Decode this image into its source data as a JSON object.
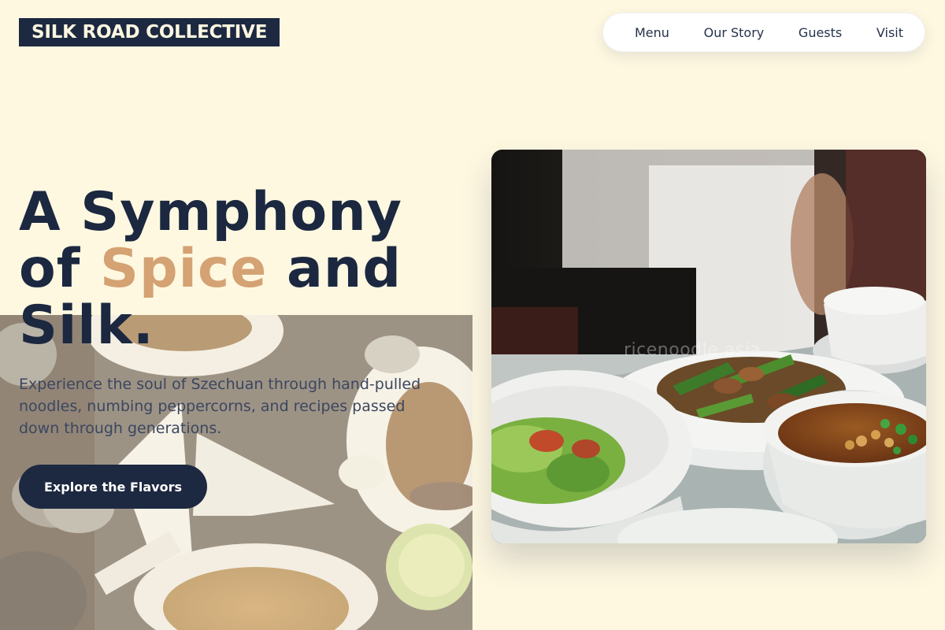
{
  "header": {
    "logo": "SILK ROAD COLLECTIVE",
    "nav": [
      {
        "label": "Menu"
      },
      {
        "label": "Our Story"
      },
      {
        "label": "Guests"
      },
      {
        "label": "Visit"
      }
    ]
  },
  "hero": {
    "title_line1": "A Symphony",
    "title_of": "of ",
    "title_accent": "Spice",
    "title_and": " and",
    "title_line3": "Silk.",
    "subtitle": "Experience the soul of Szechuan through hand-pulled noodles, numbing peppercorns, and recipes passed down through generations.",
    "cta_label": "Explore the Flavors"
  },
  "photo": {
    "watermark": "ricenoodle.asia"
  },
  "colors": {
    "background": "#fef8e1",
    "navy": "#1d2941",
    "accent": "#d4a273"
  }
}
